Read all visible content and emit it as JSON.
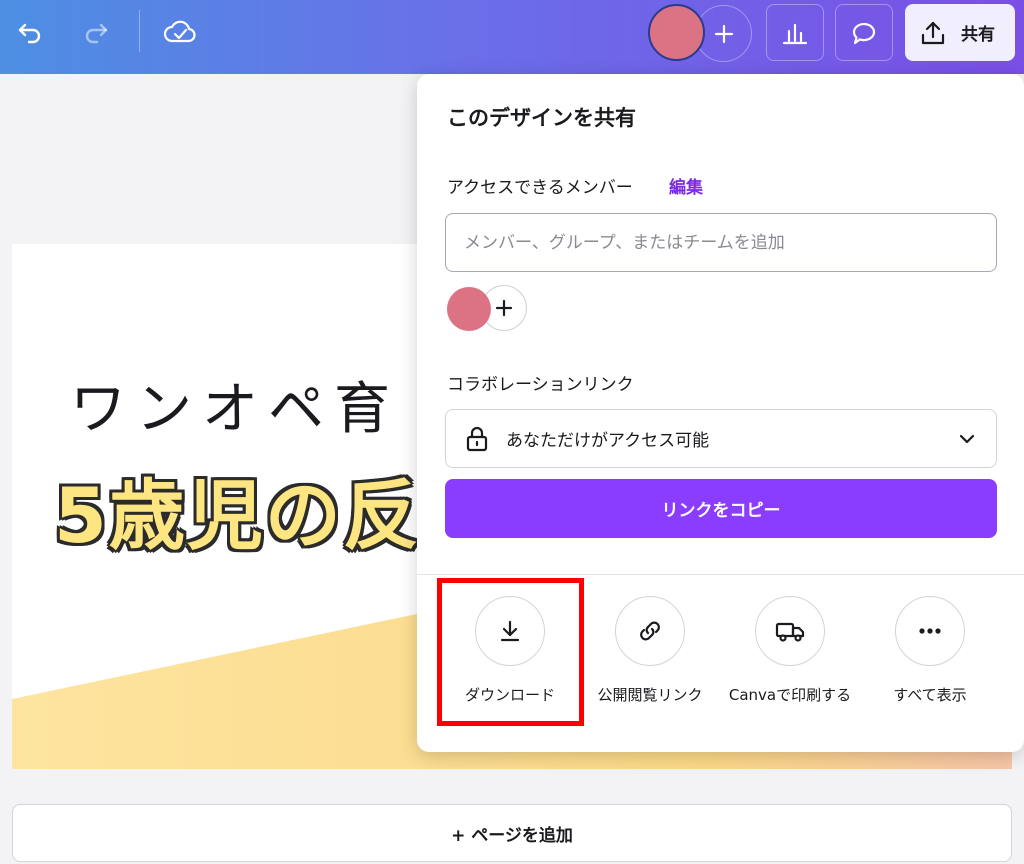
{
  "topbar": {
    "share_label": "共有",
    "icons": [
      "undo-icon",
      "redo-icon",
      "cloud-saved-icon",
      "add-icon",
      "insights-icon",
      "comment-icon",
      "share-upload-icon"
    ]
  },
  "canvas": {
    "handwritten_text": "ワンオペ育",
    "big_title": "5歳児の反"
  },
  "add_page_label": "+ ページを追加",
  "share_panel": {
    "title": "このデザインを共有",
    "members_label": "アクセスできるメンバー",
    "members_edit": "編集",
    "member_input_placeholder": "メンバー、グループ、またはチームを追加",
    "collab_link_label": "コラボレーションリンク",
    "collab_access": "あなただけがアクセス可能",
    "copy_link_label": "リンクをコピー",
    "actions": [
      {
        "label": "ダウンロード",
        "icon": "download-icon"
      },
      {
        "label": "公開閲覧リンク",
        "icon": "link-icon"
      },
      {
        "label": "Canvaで印刷する",
        "icon": "truck-icon"
      },
      {
        "label": "すべて表示",
        "icon": "more-icon"
      }
    ]
  },
  "colors": {
    "accent": "#8b3dff",
    "highlight": "#ff0000",
    "avatar": "#dc7385"
  }
}
